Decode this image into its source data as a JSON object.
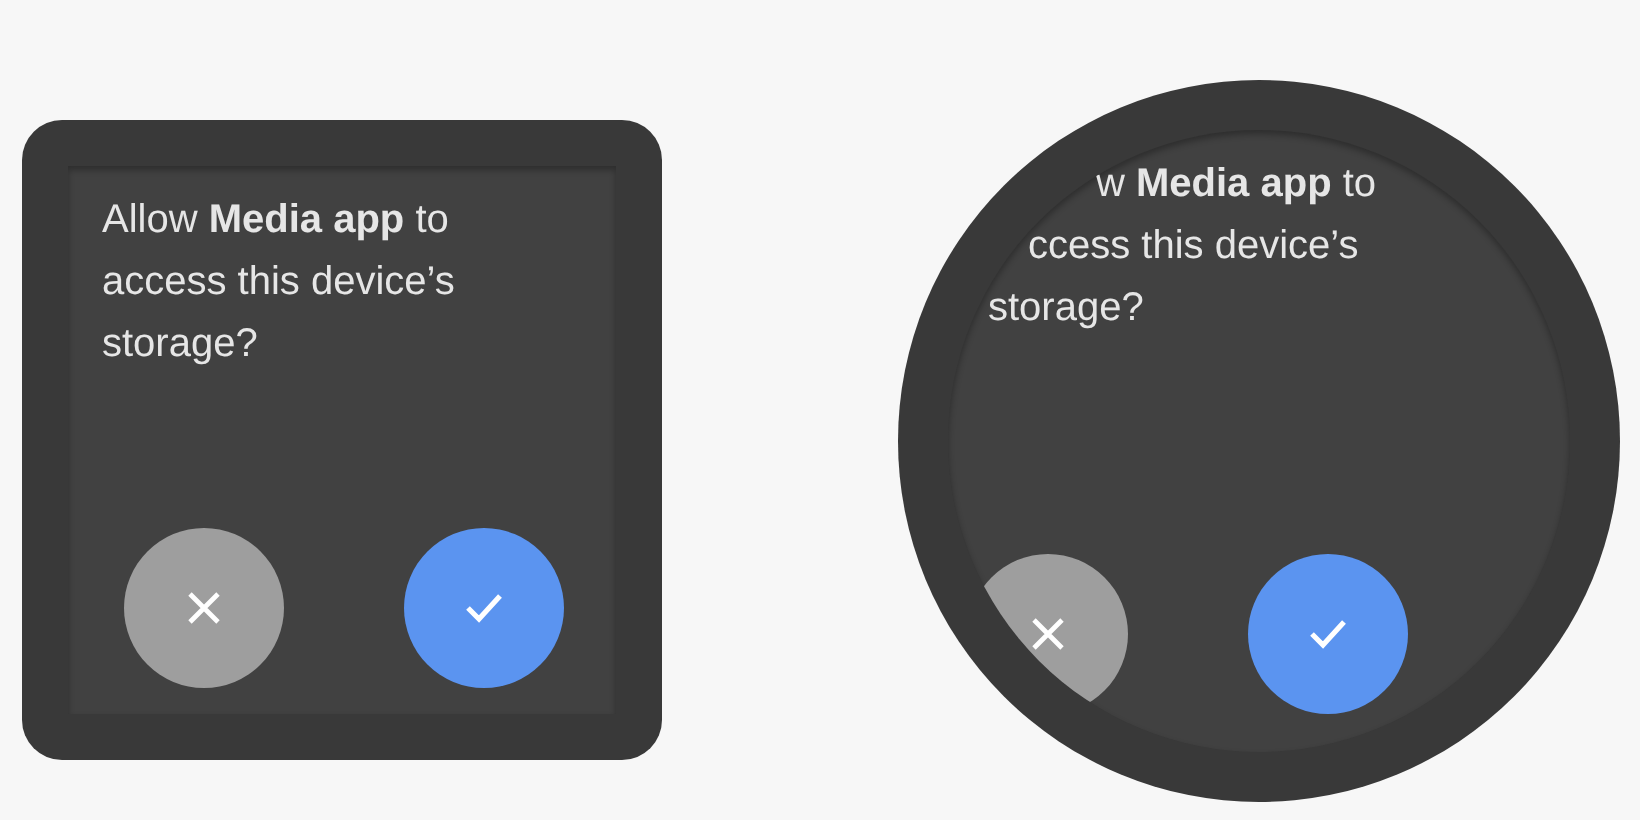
{
  "watches": [
    {
      "kind": "square",
      "message": [
        "Allow **Media app** to",
        "access this device’s",
        "storage?"
      ],
      "buttons": [
        {
          "kind": "cancel"
        },
        {
          "kind": "confirm"
        }
      ]
    },
    {
      "kind": "round",
      "message": [
        "w **Media app** to",
        "ccess this device’s",
        "storage?"
      ],
      "buttons": [
        {
          "kind": "cancel"
        },
        {
          "kind": "confirm"
        }
      ]
    }
  ]
}
